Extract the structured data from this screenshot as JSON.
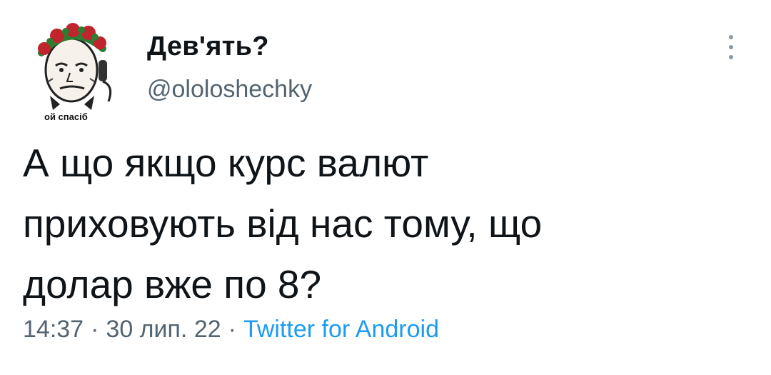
{
  "author": {
    "display_name": "Дев'ять?",
    "handle": "@ololoshechky",
    "avatar_caption": "ой спасіб"
  },
  "tweet": {
    "text": "А що якщо курс валют\nприховують від нас тому, що\nдолар вже по 8?",
    "time": "14:37",
    "date": "30 лип. 22",
    "source": "Twitter for Android",
    "separator": "·"
  },
  "icons": {
    "more": "more-vertical-icon",
    "avatar": "meme-face-with-phone-avatar"
  },
  "colors": {
    "text": "#0f1419",
    "secondary": "#536471",
    "link": "#1d9bf0",
    "avatar_flowers": "#c0242c",
    "avatar_leaves": "#2e7d32"
  }
}
